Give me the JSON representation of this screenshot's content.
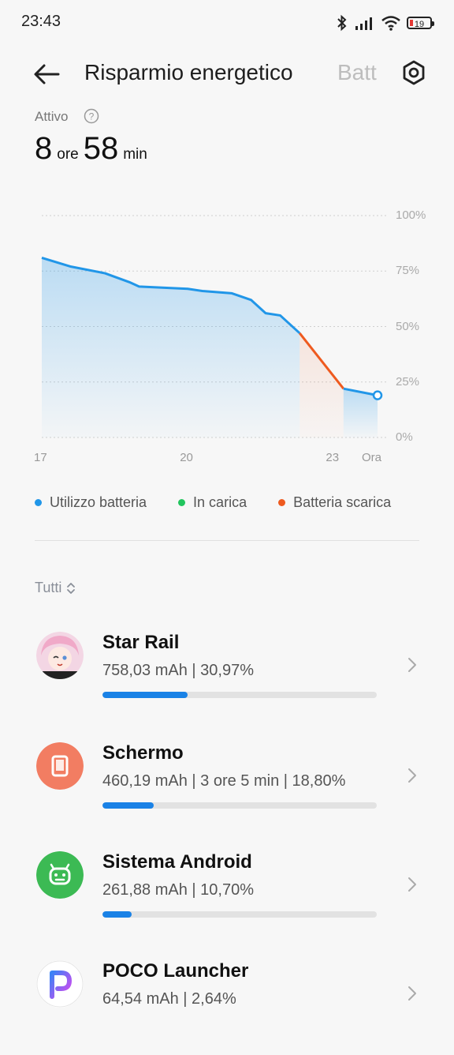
{
  "status_bar": {
    "time": "23:43",
    "battery_level": "19",
    "icons": [
      "bluetooth-icon",
      "signal-icon",
      "wifi-icon",
      "battery-icon"
    ]
  },
  "header": {
    "title": "Risparmio energetico",
    "next_tab": "Batt"
  },
  "summary": {
    "label": "Attivo",
    "hours": "8",
    "hours_unit": "ore",
    "minutes": "58",
    "minutes_unit": "min"
  },
  "chart_data": {
    "type": "area",
    "y_ticks": [
      "100%",
      "75%",
      "50%",
      "25%",
      "0%"
    ],
    "x_ticks": [
      "17",
      "20",
      "23",
      "Ora"
    ],
    "ylim": [
      0,
      100
    ],
    "series": [
      {
        "name": "Utilizzo batteria",
        "color": "#2196e8",
        "points": [
          [
            17.0,
            81
          ],
          [
            17.6,
            77
          ],
          [
            18.3,
            74
          ],
          [
            18.8,
            70
          ],
          [
            19.0,
            68
          ],
          [
            20.0,
            67
          ],
          [
            20.3,
            66
          ],
          [
            20.9,
            65
          ],
          [
            21.3,
            62
          ],
          [
            21.6,
            56
          ],
          [
            21.9,
            55
          ],
          [
            22.3,
            47
          ]
        ]
      },
      {
        "name": "Batteria scarica",
        "color": "#ee5a1f",
        "points": [
          [
            22.3,
            47
          ],
          [
            23.2,
            22
          ]
        ]
      },
      {
        "name": "Utilizzo batteria",
        "color": "#2196e8",
        "points": [
          [
            23.2,
            22
          ],
          [
            23.9,
            19
          ]
        ]
      }
    ],
    "grid": true
  },
  "legend": [
    {
      "label": "Utilizzo batteria",
      "color": "#2196e8"
    },
    {
      "label": "In carica",
      "color": "#22c55e"
    },
    {
      "label": "Batteria scarica",
      "color": "#ee5a1f"
    }
  ],
  "filter": {
    "label": "Tutti"
  },
  "apps": [
    {
      "name": "Star Rail",
      "stats": "758,03 mAh | 30,97%",
      "fraction": 0.3097,
      "icon": "star-rail-icon"
    },
    {
      "name": "Schermo",
      "stats": "460,19 mAh | 3 ore 5 min  | 18,80%",
      "fraction": 0.188,
      "icon": "screen-icon"
    },
    {
      "name": "Sistema Android",
      "stats": "261,88 mAh | 10,70%",
      "fraction": 0.107,
      "icon": "android-icon"
    },
    {
      "name": "POCO Launcher",
      "stats": "64,54 mAh | 2,64%",
      "fraction": 0.0264,
      "icon": "poco-launcher-icon"
    }
  ]
}
